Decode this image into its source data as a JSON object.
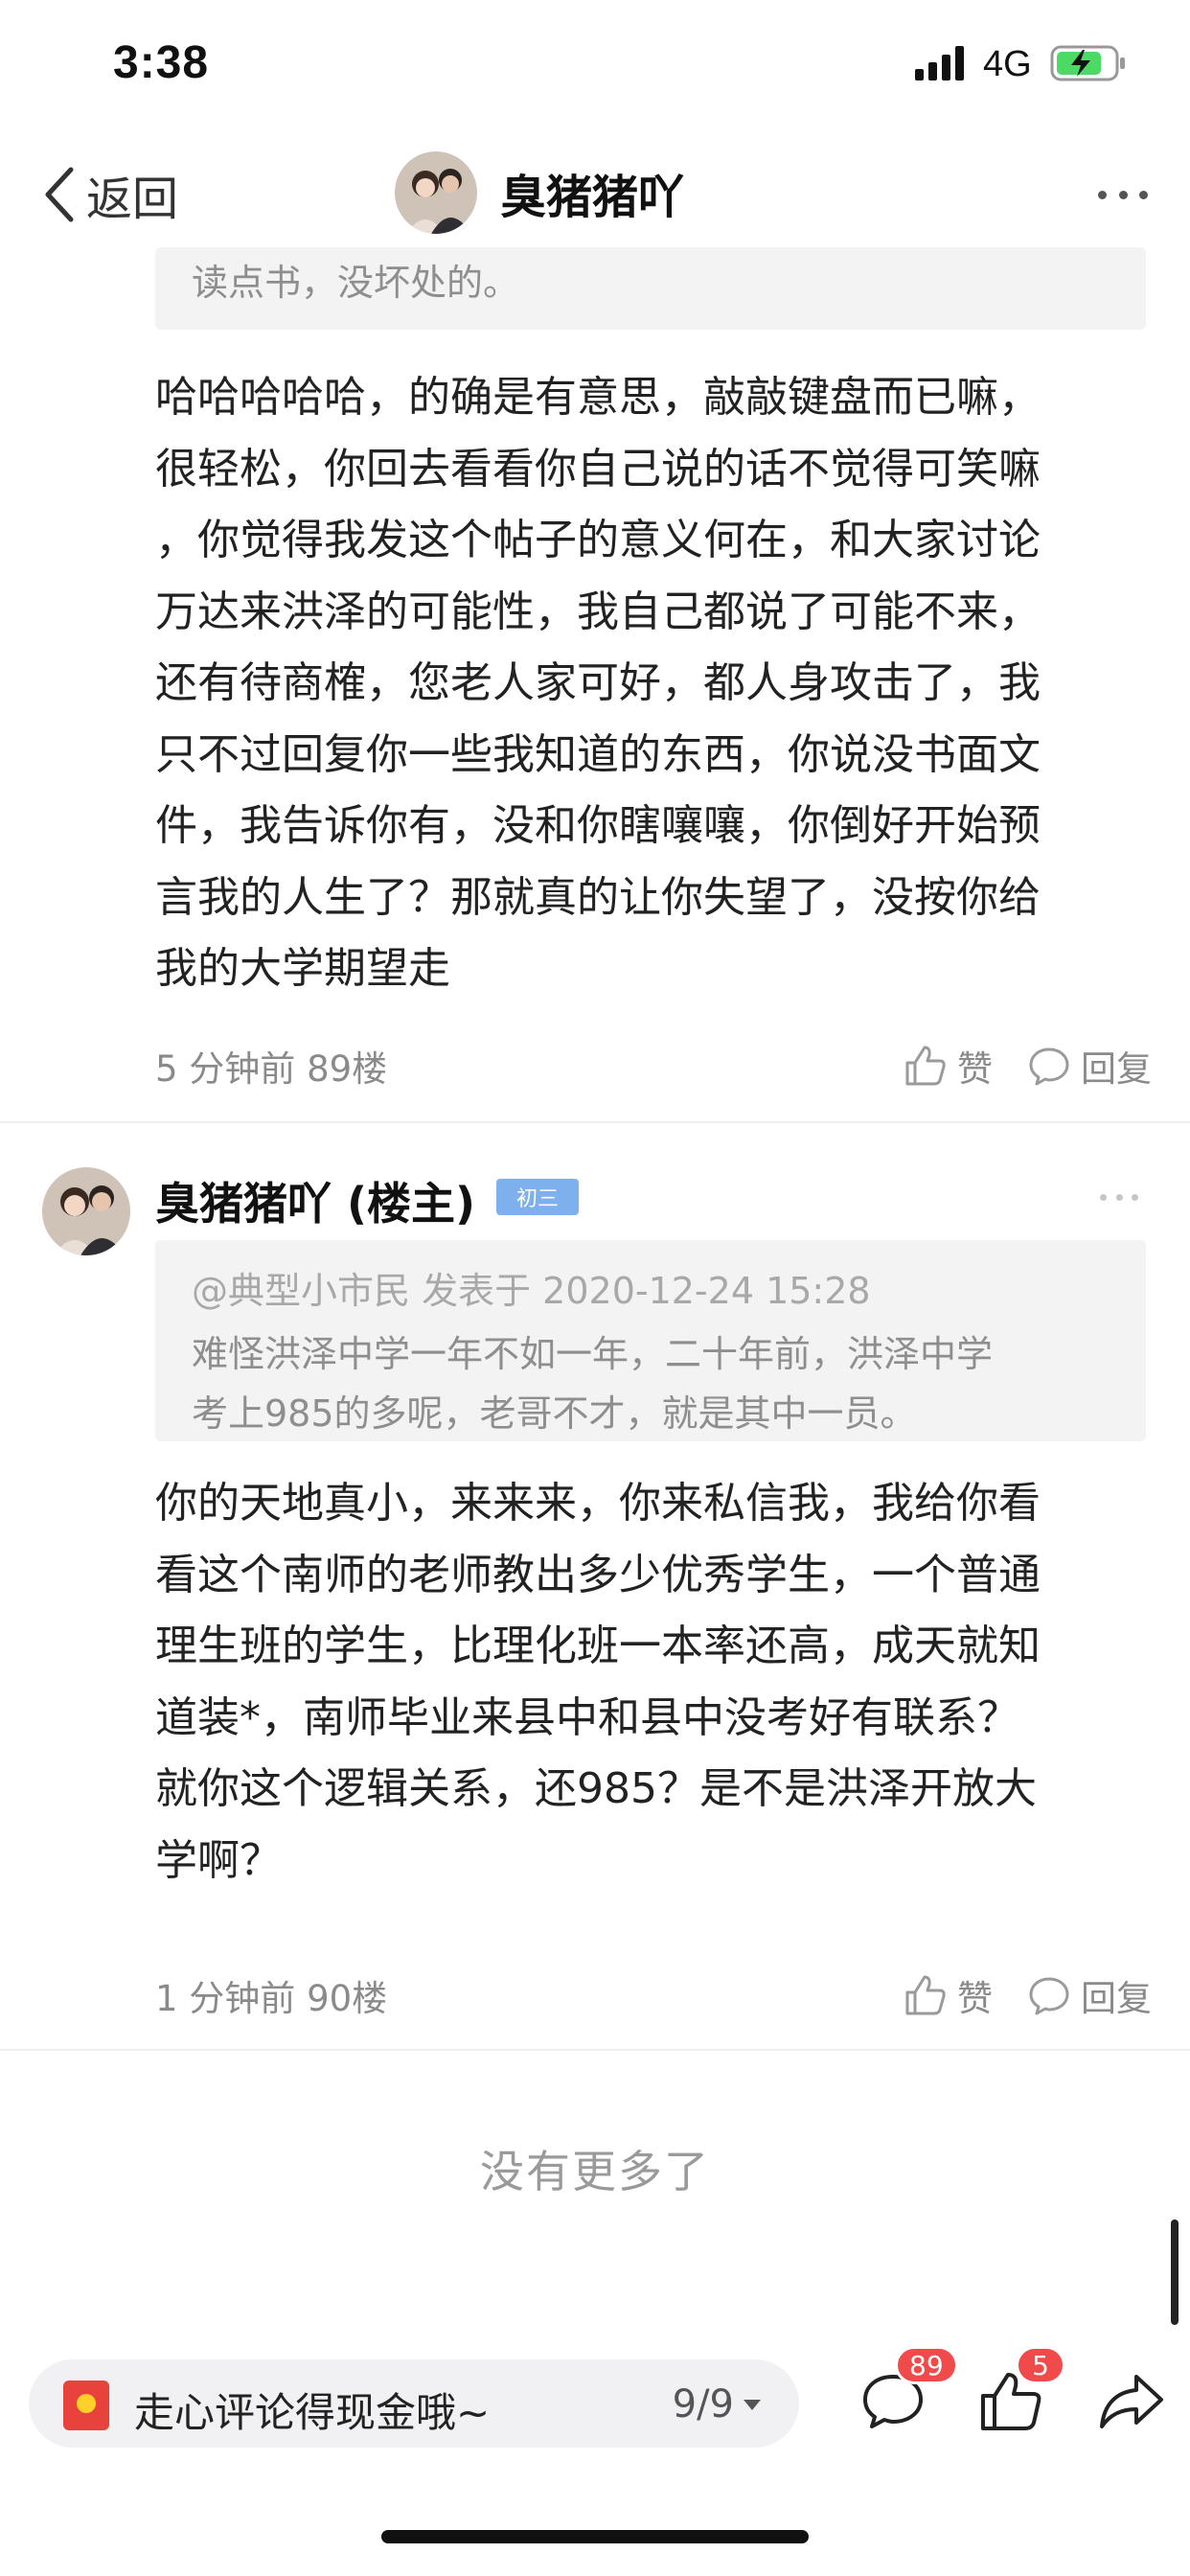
{
  "status_bar": {
    "time": "3:38",
    "network": "4G"
  },
  "nav": {
    "back_label": "返回",
    "title": "臭猪猪吖"
  },
  "thread": {
    "partial_quote": "读点书，没坏处的。",
    "post_89": {
      "lines": [
        "哈哈哈哈哈，的确是有意思，敲敲键盘而已嘛，",
        "很轻松，你回去看看你自己说的话不觉得可笑嘛",
        "，你觉得我发这个帖子的意义何在，和大家讨论",
        "万达来洪泽的可能性，我自己都说了可能不来，",
        "还有待商榷，您老人家可好，都人身攻击了，我",
        "只不过回复你一些我知道的东西，你说没书面文",
        "件，我告诉你有，没和你瞎嚷嚷，你倒好开始预",
        "言我的人生了？那就真的让你失望了，没按你给",
        "我的大学期望走"
      ],
      "meta": "5 分钟前  89楼",
      "like_label": "赞",
      "reply_label": "回复"
    },
    "post_90": {
      "author": "臭猪猪吖 (楼主)",
      "grade_badge": "初三",
      "quote_head": "@典型小市民 发表于 2020-12-24 15:28",
      "quote_lines": [
        "难怪洪泽中学一年不如一年，二十年前，洪泽中学",
        "考上985的多呢，老哥不才，就是其中一员。"
      ],
      "lines": [
        "你的天地真小，来来来，你来私信我，我给你看",
        "看这个南师的老师教出多少优秀学生，一个普通",
        "理生班的学生，比理化班一本率还高，成天就知",
        "道装*，南师毕业来县中和县中没考好有联系？",
        "就你这个逻辑关系，还985？是不是洪泽开放大",
        "学啊？"
      ],
      "meta": "1 分钟前  90楼",
      "like_label": "赞",
      "reply_label": "回复"
    },
    "no_more": "没有更多了"
  },
  "bottom_bar": {
    "comment_placeholder": "走心评论得现金哦~",
    "page_indicator": "9/9",
    "comment_count": "89",
    "like_count": "5"
  },
  "colors": {
    "badge_red": "#f04a4a",
    "grade_blue": "#7fb0ee",
    "quote_bg": "#f3f3f4"
  }
}
